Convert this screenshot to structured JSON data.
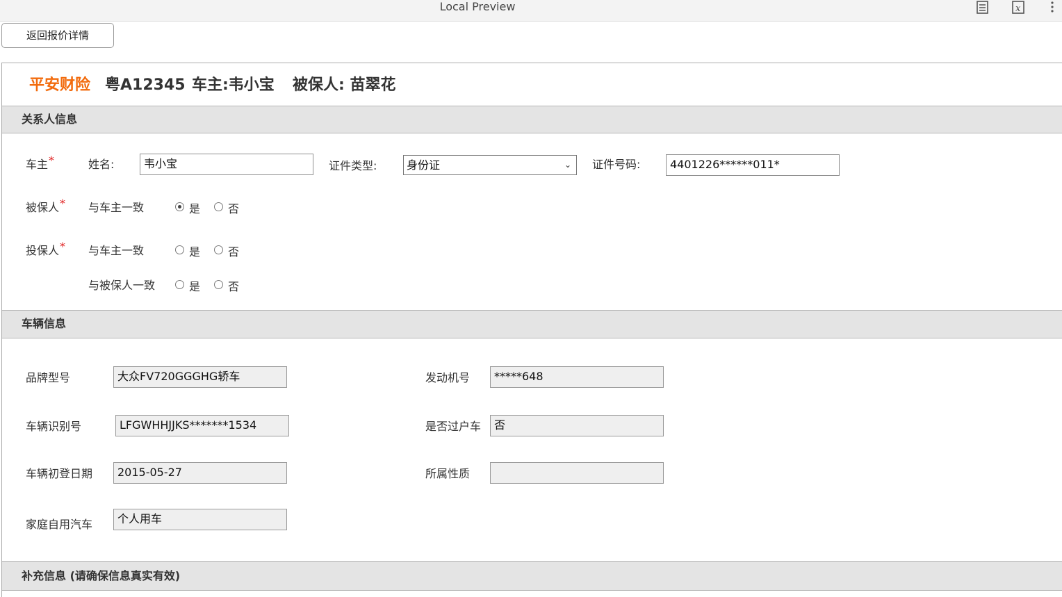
{
  "window": {
    "title": "Local Preview",
    "icons": [
      "document-list-icon",
      "variable-x-icon",
      "more-vertical-icon"
    ]
  },
  "back_button": {
    "label": "返回报价详情"
  },
  "headline": {
    "insurer": "平安财险",
    "plate": "粤A12345",
    "owner": "车主:韦小宝",
    "insured": "被保人: 苗翠花",
    "accent_color": "#f26b0d"
  },
  "contact_section": {
    "title": "关系人信息",
    "owner": {
      "label": "车主",
      "required_mark": "*",
      "name_label": "姓名:",
      "name_value": "韦小宝",
      "id_type_label": "证件类型:",
      "id_type_value": "身份证",
      "id_number_label": "证件号码:",
      "id_number_value": "4401226******011*"
    },
    "insured": {
      "label": "被保人",
      "required_mark": "*",
      "question": "与车主一致",
      "yes": "是",
      "no": "否",
      "selected": "yes"
    },
    "policyholder": {
      "label": "投保人",
      "required_mark": "*",
      "question_owner": "与车主一致",
      "question_insured": "与被保人一致",
      "yes": "是",
      "no": "否",
      "selected_owner": "none",
      "selected_insured": "none"
    }
  },
  "vehicle_section": {
    "title": "车辆信息",
    "brand_model_label": "品牌型号",
    "brand_model_value": "大众FV720GGGHG轿车",
    "engine_no_label": "发动机号",
    "engine_no_value": "*****648",
    "vin_label": "车辆识别号",
    "vin_value": "LFGWHHJJKS*******1534",
    "transfer_label": "是否过户车",
    "transfer_value": "否",
    "first_reg_label": "车辆初登日期",
    "first_reg_value": "2015-05-27",
    "ownership_label": "所属性质",
    "ownership_value": "",
    "usage_label": "家庭自用汽车",
    "usage_value": "个人用车"
  },
  "supplement_section": {
    "title": "补充信息 (请确保信息真实有效)"
  }
}
